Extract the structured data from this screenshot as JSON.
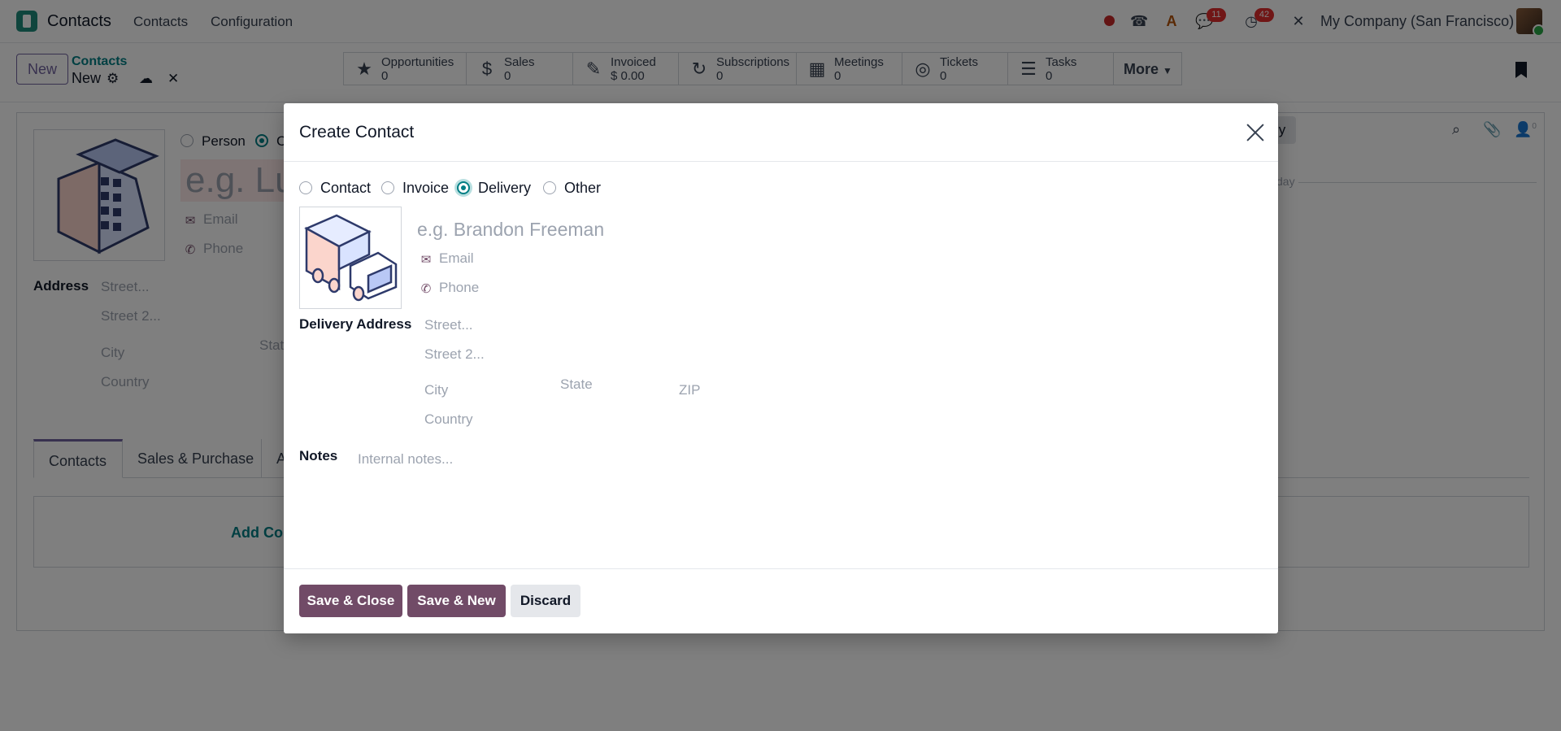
{
  "navbar": {
    "app_name": "Contacts",
    "menus": [
      "Contacts",
      "Configuration"
    ],
    "badges": {
      "messages": "11",
      "activities": "42"
    },
    "company": "My Company (San Francisco)",
    "icons": [
      "record-dot-icon",
      "phone-icon",
      "ai-icon",
      "chat-icon",
      "clock-icon",
      "tools-icon"
    ]
  },
  "control_panel": {
    "new_label": "New",
    "breadcrumb_parent": "Contacts",
    "breadcrumb_current": "New",
    "smart_buttons": [
      {
        "label": "Opportunities",
        "value": "0",
        "icon": "star-icon"
      },
      {
        "label": "Sales",
        "value": "0",
        "icon": "dollar-icon"
      },
      {
        "label": "Invoiced",
        "value": "$ 0.00",
        "icon": "invoice-icon"
      },
      {
        "label": "Subscriptions",
        "value": "0",
        "icon": "refresh-icon"
      },
      {
        "label": "Meetings",
        "value": "0",
        "icon": "calendar-icon"
      },
      {
        "label": "Tickets",
        "value": "0",
        "icon": "lifebuoy-icon"
      },
      {
        "label": "Tasks",
        "value": "0",
        "icon": "tasks-icon"
      }
    ],
    "more_label": "More"
  },
  "background_form": {
    "type_person": "Person",
    "type_company_initial": "C",
    "name_placeholder": "e.g. Lu",
    "email": "Email",
    "phone": "Phone",
    "address_label": "Address",
    "street": "Street...",
    "street2": "Street 2...",
    "city": "City",
    "state": "Stat",
    "country": "Country",
    "tabs": [
      "Contacts",
      "Sales & Purchase",
      "A"
    ],
    "add_contact": "Add Con",
    "chatter_button": "y",
    "chatter_today": "day",
    "followers_count": "0"
  },
  "modal": {
    "title": "Create Contact",
    "types": [
      {
        "label": "Contact",
        "checked": false
      },
      {
        "label": "Invoice",
        "checked": false
      },
      {
        "label": "Delivery",
        "checked": true
      },
      {
        "label": "Other",
        "checked": false
      }
    ],
    "name_placeholder": "e.g. Brandon Freeman",
    "email_placeholder": "Email",
    "phone_placeholder": "Phone",
    "address_label": "Delivery Address",
    "street_placeholder": "Street...",
    "street2_placeholder": "Street 2...",
    "city_placeholder": "City",
    "state_placeholder": "State",
    "zip_placeholder": "ZIP",
    "country_placeholder": "Country",
    "notes_label": "Notes",
    "notes_placeholder": "Internal notes...",
    "buttons": {
      "save_close": "Save & Close",
      "save_new": "Save & New",
      "discard": "Discard"
    }
  },
  "colors": {
    "primary": "#714b67",
    "accent": "#017e84",
    "badge": "#e02d2d"
  }
}
